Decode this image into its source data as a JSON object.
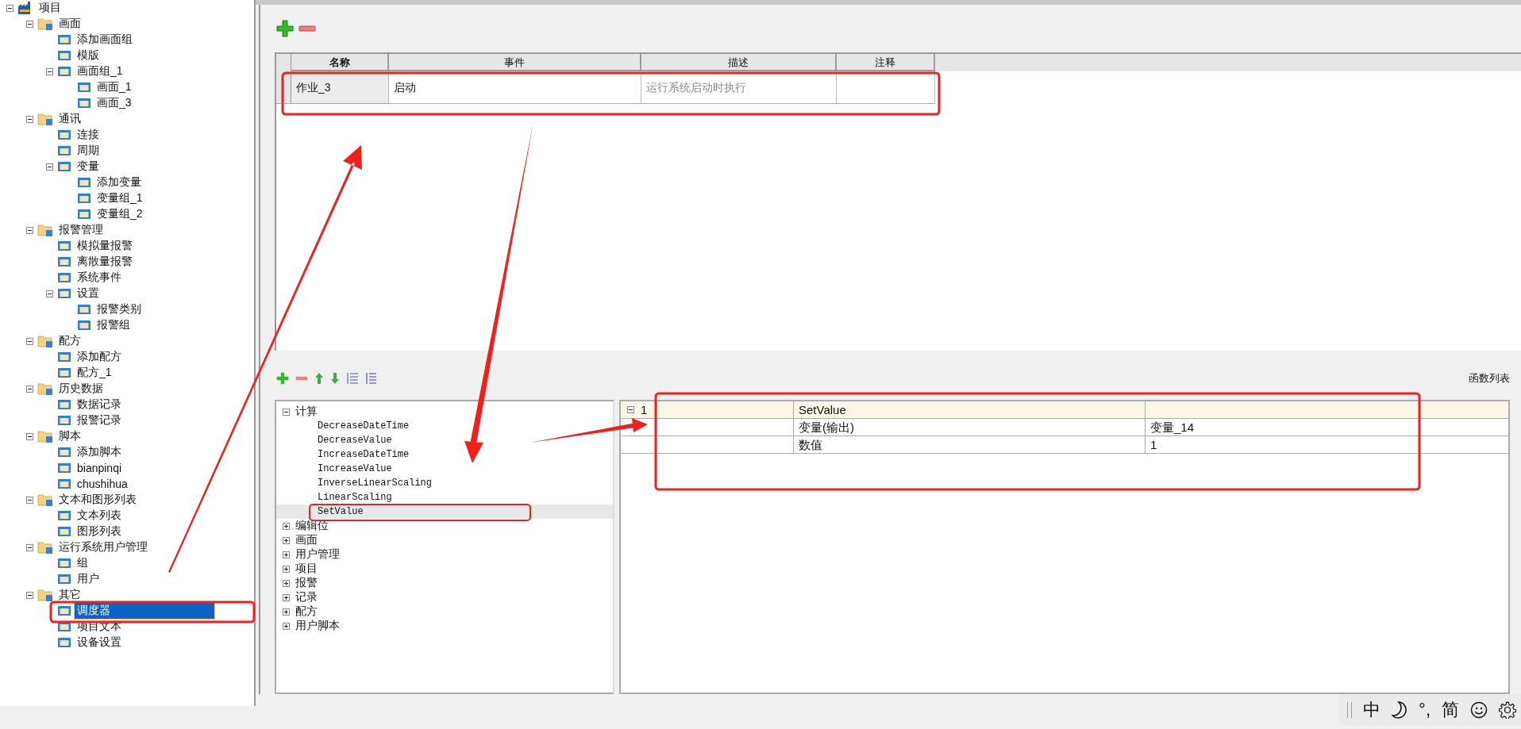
{
  "project_tree": {
    "items": [
      {
        "label": "项目",
        "kind": "root",
        "expanded": true,
        "selected": false,
        "children": [
          {
            "label": "画面",
            "kind": "folder",
            "expanded": true,
            "selected": false,
            "children": [
              {
                "label": "添加画面组",
                "kind": "item",
                "selected": false
              },
              {
                "label": "模版",
                "kind": "item",
                "selected": false
              },
              {
                "label": "画面组_1",
                "kind": "item",
                "expanded": true,
                "selected": false,
                "children": [
                  {
                    "label": "画面_1",
                    "kind": "item",
                    "selected": false
                  },
                  {
                    "label": "画面_3",
                    "kind": "item",
                    "selected": false
                  }
                ]
              }
            ]
          },
          {
            "label": "通讯",
            "kind": "folder",
            "expanded": true,
            "selected": false,
            "children": [
              {
                "label": "连接",
                "kind": "item",
                "selected": false
              },
              {
                "label": "周期",
                "kind": "item",
                "selected": false
              },
              {
                "label": "变量",
                "kind": "item",
                "expanded": true,
                "selected": false,
                "children": [
                  {
                    "label": "添加变量",
                    "kind": "item",
                    "selected": false
                  },
                  {
                    "label": "变量组_1",
                    "kind": "item",
                    "selected": false
                  },
                  {
                    "label": "变量组_2",
                    "kind": "item",
                    "selected": false
                  }
                ]
              }
            ]
          },
          {
            "label": "报警管理",
            "kind": "folder",
            "expanded": true,
            "selected": false,
            "children": [
              {
                "label": "模拟量报警",
                "kind": "item",
                "selected": false
              },
              {
                "label": "离散量报警",
                "kind": "item",
                "selected": false
              },
              {
                "label": "系统事件",
                "kind": "item",
                "selected": false
              },
              {
                "label": "设置",
                "kind": "item",
                "expanded": true,
                "selected": false,
                "children": [
                  {
                    "label": "报警类别",
                    "kind": "item",
                    "selected": false
                  },
                  {
                    "label": "报警组",
                    "kind": "item",
                    "selected": false
                  }
                ]
              }
            ]
          },
          {
            "label": "配方",
            "kind": "folder",
            "expanded": true,
            "selected": false,
            "children": [
              {
                "label": "添加配方",
                "kind": "item",
                "selected": false
              },
              {
                "label": "配方_1",
                "kind": "item",
                "selected": false
              }
            ]
          },
          {
            "label": "历史数据",
            "kind": "folder",
            "expanded": true,
            "selected": false,
            "children": [
              {
                "label": "数据记录",
                "kind": "item",
                "selected": false
              },
              {
                "label": "报警记录",
                "kind": "item",
                "selected": false
              }
            ]
          },
          {
            "label": "脚本",
            "kind": "folder",
            "expanded": true,
            "selected": false,
            "children": [
              {
                "label": "添加脚本",
                "kind": "item",
                "selected": false
              },
              {
                "label": "bianpinqi",
                "kind": "item",
                "selected": false
              },
              {
                "label": "chushihua",
                "kind": "item",
                "selected": false
              }
            ]
          },
          {
            "label": "文本和图形列表",
            "kind": "folder",
            "expanded": true,
            "selected": false,
            "children": [
              {
                "label": "文本列表",
                "kind": "item",
                "selected": false
              },
              {
                "label": "图形列表",
                "kind": "item",
                "selected": false
              }
            ]
          },
          {
            "label": "运行系统用户管理",
            "kind": "folder",
            "expanded": true,
            "selected": false,
            "children": [
              {
                "label": "组",
                "kind": "item",
                "selected": false
              },
              {
                "label": "用户",
                "kind": "item",
                "selected": false
              }
            ]
          },
          {
            "label": "其它",
            "kind": "folder",
            "expanded": true,
            "selected": false,
            "children": [
              {
                "label": "调度器",
                "kind": "item",
                "selected": true
              },
              {
                "label": "项目文本",
                "kind": "item",
                "selected": false
              },
              {
                "label": "设备设置",
                "kind": "item",
                "selected": false
              }
            ]
          }
        ]
      }
    ]
  },
  "scheduler_table": {
    "columns": [
      "名称",
      "事件",
      "描述",
      "注释"
    ],
    "rows": [
      {
        "name": "作业_3",
        "event": "启动",
        "description": "运行系统启动时执行",
        "selected": false
      }
    ]
  },
  "function_tree": {
    "items": [
      {
        "label": "计算",
        "expanded": true,
        "selected": false,
        "children": [
          {
            "label": "DecreaseDateTime",
            "selected": false
          },
          {
            "label": "DecreaseValue",
            "selected": false
          },
          {
            "label": "IncreaseDateTime",
            "selected": false
          },
          {
            "label": "IncreaseValue",
            "selected": false
          },
          {
            "label": "InverseLinearScaling",
            "selected": false
          },
          {
            "label": "LinearScaling",
            "selected": false
          },
          {
            "label": "SetValue",
            "selected": true
          }
        ]
      },
      {
        "label": "编辑位",
        "expanded": false,
        "selected": false
      },
      {
        "label": "画面",
        "expanded": false,
        "selected": false
      },
      {
        "label": "用户管理",
        "expanded": false,
        "selected": false
      },
      {
        "label": "项目",
        "expanded": false,
        "selected": false
      },
      {
        "label": "报警",
        "expanded": false,
        "selected": false
      },
      {
        "label": "记录",
        "expanded": false,
        "selected": false
      },
      {
        "label": "配方",
        "expanded": false,
        "selected": false
      },
      {
        "label": "用户脚本",
        "expanded": false,
        "selected": false
      }
    ]
  },
  "function_list": {
    "label": "函数列表",
    "rows": [
      {
        "kind": "function",
        "index": "1",
        "expanded": true,
        "name": "SetValue"
      },
      {
        "kind": "param",
        "name": "变量(输出)",
        "value": "变量_14"
      },
      {
        "kind": "param",
        "name": "数值",
        "value": "1"
      }
    ]
  },
  "ime_bar": {
    "items": [
      {
        "kind": "text",
        "text": "中"
      },
      {
        "kind": "moon"
      },
      {
        "kind": "text",
        "text": "°,"
      },
      {
        "kind": "text",
        "text": "简"
      },
      {
        "kind": "smiley"
      },
      {
        "kind": "gear"
      }
    ]
  }
}
